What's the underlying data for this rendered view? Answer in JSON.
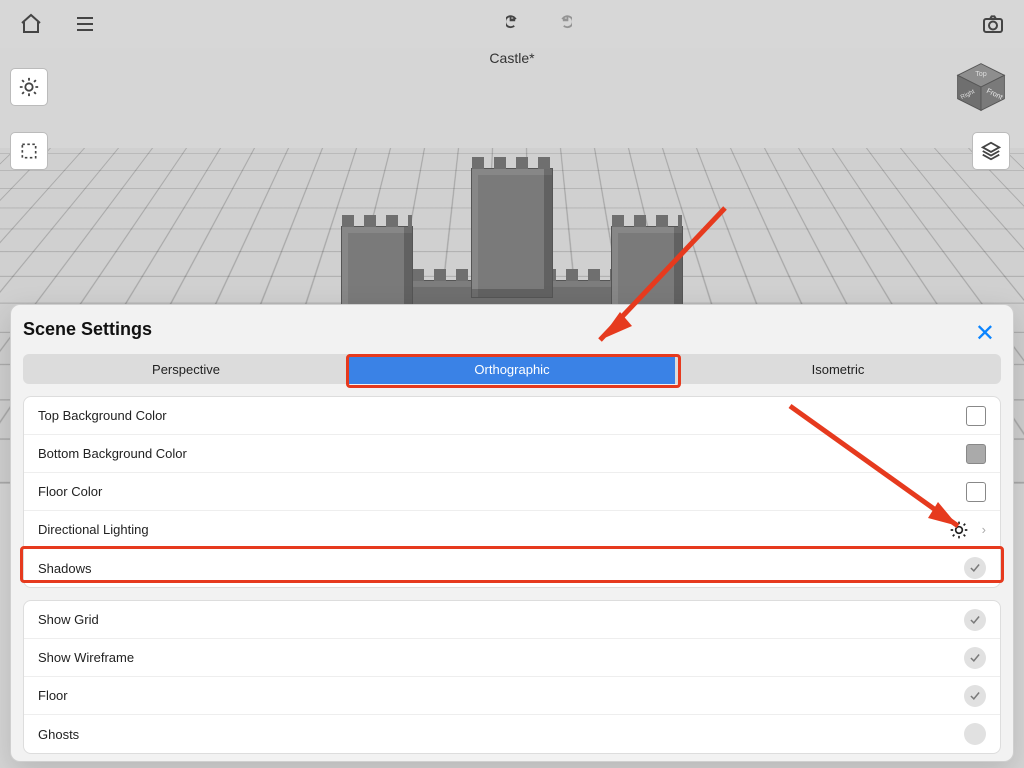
{
  "document": {
    "title": "Castle*"
  },
  "panel": {
    "title": "Scene Settings",
    "tabs": [
      "Perspective",
      "Orthographic",
      "Isometric"
    ],
    "active_tab": 1,
    "group1": {
      "top_bg": "Top Background Color",
      "bottom_bg": "Bottom Background Color",
      "floor_color": "Floor Color",
      "directional": "Directional Lighting",
      "shadows": "Shadows"
    },
    "group2": {
      "show_grid": "Show Grid",
      "show_wire": "Show Wireframe",
      "floor": "Floor",
      "ghosts": "Ghosts"
    }
  },
  "icons": {
    "home": "home-icon",
    "menu": "menu-icon",
    "undo": "undo-icon",
    "redo": "redo-icon",
    "camera": "camera-icon",
    "sun": "sun-icon",
    "select": "selection-icon",
    "layers": "layers-icon",
    "close": "close-icon",
    "chevron": "chevron-right-icon"
  }
}
